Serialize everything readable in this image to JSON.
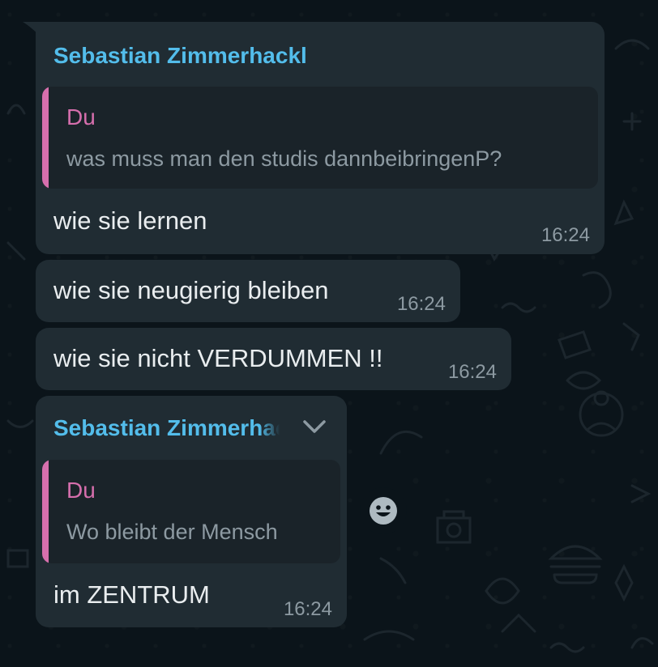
{
  "messages": [
    {
      "sender": "Sebastian Zimmerhackl",
      "quote": {
        "author": "Du",
        "text": "was muss man den studis dannbeibringenP?"
      },
      "text": "wie sie lernen",
      "time": "16:24"
    },
    {
      "text": "wie sie neugierig bleiben",
      "time": "16:24"
    },
    {
      "text": "wie sie nicht VERDUMMEN !!",
      "time": "16:24"
    },
    {
      "sender": "Sebastian Zimmerhackl",
      "quote": {
        "author": "Du",
        "text": "Wo bleibt der Mensch"
      },
      "text": "im ZENTRUM",
      "time": "16:24"
    }
  ],
  "icons": {
    "context_menu": "chevron-down-icon",
    "reaction": "emoji-smile-icon"
  },
  "colors": {
    "background": "#0b141a",
    "bubble": "#202c33",
    "sender": "#53bdeb",
    "quote_accent": "#d66fad",
    "text": "#e9edef",
    "meta": "#8d9aa2"
  }
}
